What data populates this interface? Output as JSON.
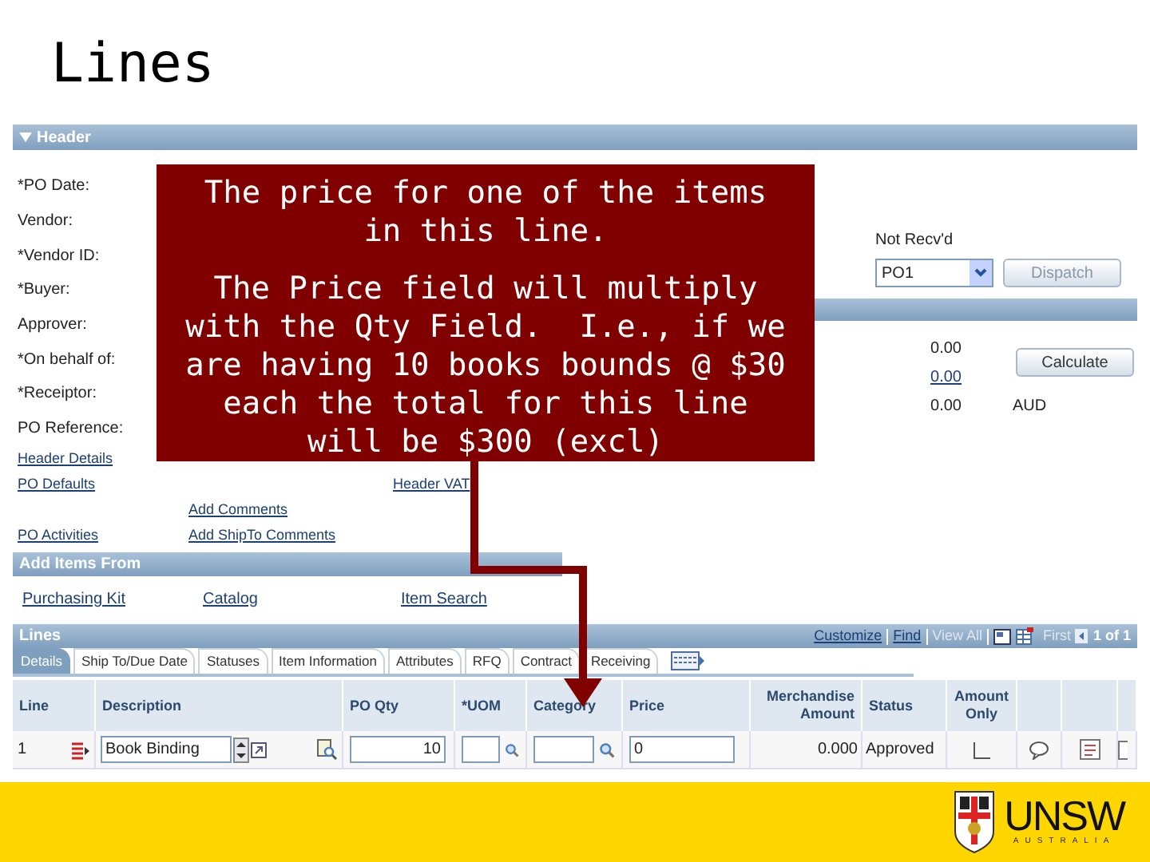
{
  "slide_title": "Lines",
  "header": {
    "title": "Header",
    "expanded": true,
    "labels": [
      "*PO Date:",
      "Vendor:",
      "*Vendor ID:",
      "*Buyer:",
      "Approver:",
      "*On behalf of:",
      "*Receiptor:",
      "PO Reference:"
    ],
    "link_rows": [
      [
        "Header Details",
        null,
        null
      ],
      [
        "PO Defaults",
        null,
        "Header VAT"
      ],
      [
        null,
        "Add Comments",
        null
      ],
      [
        "PO Activities",
        "Add ShipTo Comments",
        null
      ]
    ],
    "status_label": "Not Recv'd",
    "status_value": "PO1",
    "dispatch_button": "Dispatch",
    "calculate_button": "Calculate",
    "amounts": [
      {
        "value": "0.00",
        "link": false
      },
      {
        "value": "0.00",
        "link": true
      },
      {
        "value": "0.00",
        "link": false,
        "currency": "AUD"
      }
    ]
  },
  "add_items": {
    "title": "Add Items From",
    "links": [
      "Purchasing Kit",
      "Catalog",
      "Item Search"
    ]
  },
  "lines": {
    "title": "Lines",
    "nav": [
      {
        "text": "Customize",
        "enabled": true
      },
      {
        "text": "Find",
        "enabled": true
      },
      {
        "text": "View All",
        "enabled": false
      }
    ],
    "first": "First",
    "counter": "1 of 1",
    "tabs": [
      {
        "label": "Details",
        "selected": true
      },
      {
        "label": "Ship To/Due Date",
        "selected": false
      },
      {
        "label": "Statuses",
        "selected": false
      },
      {
        "label": "Item Information",
        "selected": false
      },
      {
        "label": "Attributes",
        "selected": false
      },
      {
        "label": "RFQ",
        "selected": false
      },
      {
        "label": "Contract",
        "selected": false
      },
      {
        "label": "Receiving",
        "selected": false
      }
    ],
    "columns": [
      "Line",
      "Description",
      "PO Qty",
      "*UOM",
      "Category",
      "Price",
      "Merchandise Amount",
      "Status",
      "Amount Only"
    ],
    "row": {
      "line": "1",
      "description": "Book Binding",
      "po_qty": "10",
      "price": "0",
      "merchandise_amount": "0.000",
      "status": "Approved",
      "amount_only": false
    }
  },
  "callout": {
    "paragraphs": [
      "The price for one of the items in this line.",
      "The Price field will multiply with the Qty Field.  I.e., if we are having 10 books bounds @ $30 each the total for this line will be $300 (excl)"
    ]
  },
  "logo": {
    "name": "UNSW",
    "subtitle": "AUSTRALIA"
  }
}
